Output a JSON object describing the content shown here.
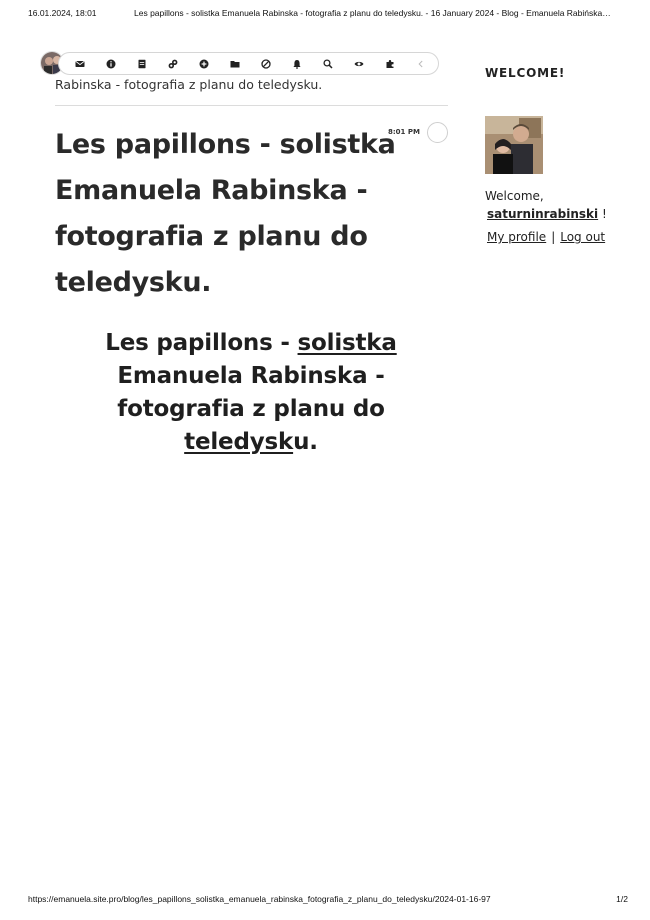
{
  "print_header": {
    "date": "16.01.2024, 18:01",
    "doc_title": "Les papillons - solistka Emanuela Rabinska - fotografia z planu do teledysku. - 16 January 2024 - Blog - Emanuela Rabińska…"
  },
  "toolbar": {
    "icons": [
      "mail-icon",
      "info-icon",
      "document-icon",
      "link-icon",
      "plus-circle-icon",
      "folder-icon",
      "block-icon",
      "bell-icon",
      "search-icon",
      "eye-icon",
      "puzzle-icon",
      "collapse-icon"
    ]
  },
  "post": {
    "subtitle_line": "Rabinska - fotografia z planu do teledysku.",
    "time": "8:01 PM",
    "title": "Les papillons - solistka Emanuela Rabinska - fotografia z planu do teledysku.",
    "heading_part1": "Les papillons - ",
    "heading_link1": "solistka",
    "heading_part2": " Emanuela Rabinska - fotografia z planu do ",
    "heading_link2": "teledysk",
    "heading_part3": "u."
  },
  "sidebar": {
    "title": "WELCOME!",
    "welcome_prefix": "Welcome,",
    "username": "saturninrabinski",
    "welcome_suffix": "!",
    "profile_link": "My profile",
    "separator": "|",
    "logout_link": "Log out"
  },
  "print_footer": {
    "url": "https://emanuela.site.pro/blog/les_papillons_solistka_emanuela_rabinska_fotografia_z_planu_do_teledysku/2024-01-16-97",
    "pager": "1/2"
  }
}
